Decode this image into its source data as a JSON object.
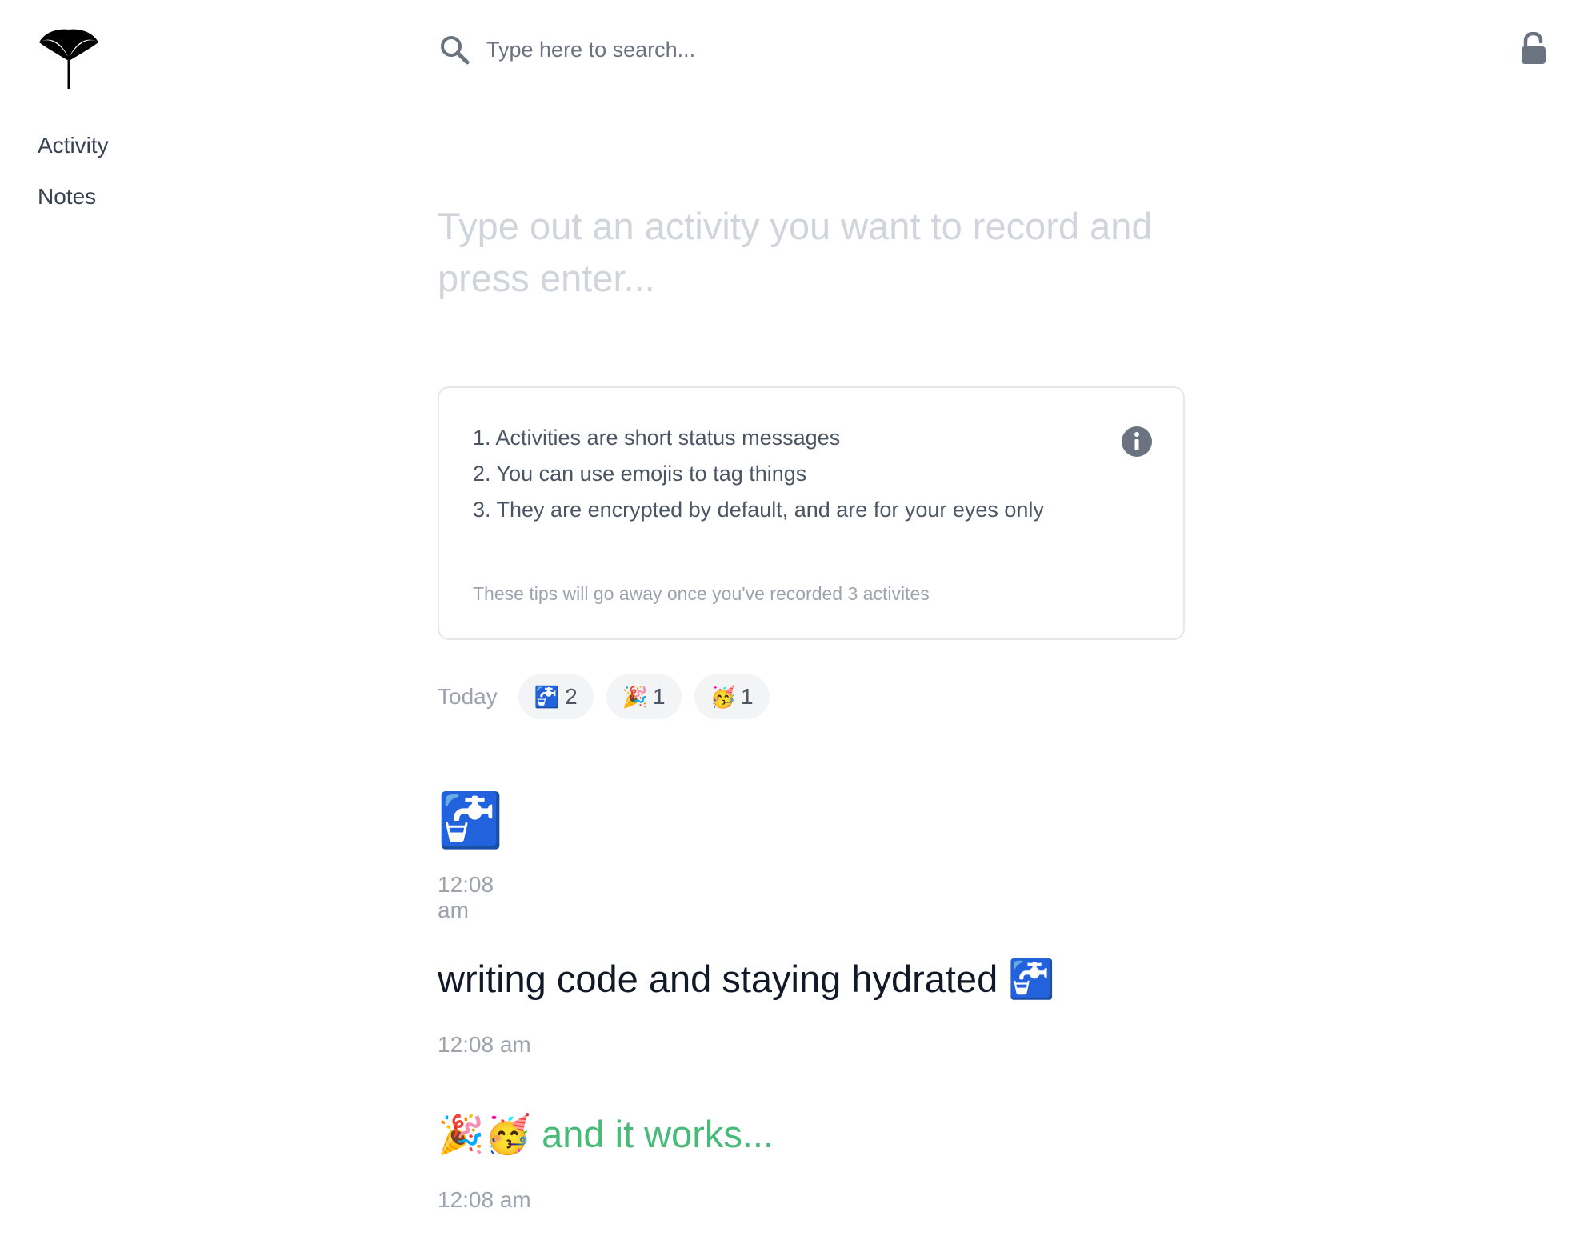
{
  "sidebar": {
    "logo": "ginkgo-leaf",
    "items": [
      {
        "label": "Activity"
      },
      {
        "label": "Notes"
      }
    ]
  },
  "search": {
    "placeholder": "Type here to search...",
    "value": ""
  },
  "composer": {
    "placeholder": "Type out an activity you want to record and press enter..."
  },
  "tips": {
    "items": [
      "1. Activities are short status messages",
      "2. You can use emojis to tag things",
      "3. They are encrypted by default, and are for your eyes only"
    ],
    "note": "These tips will go away once you've recorded 3 activites"
  },
  "day": {
    "label": "Today",
    "tags": [
      {
        "emoji": "🚰",
        "count": "2"
      },
      {
        "emoji": "🎉",
        "count": "1"
      },
      {
        "emoji": "🥳",
        "count": "1"
      }
    ]
  },
  "entries": [
    {
      "text": "🚰",
      "time": "12:08 am"
    },
    {
      "text": "writing code and staying hydrated 🚰",
      "time": "12:08 am"
    },
    {
      "text": "🎉🥳 and it works...",
      "time": "12:08 am"
    }
  ],
  "colors": {
    "accent_green": "#48bb78",
    "muted": "#9ca3af",
    "placeholder": "#d1d5db"
  }
}
